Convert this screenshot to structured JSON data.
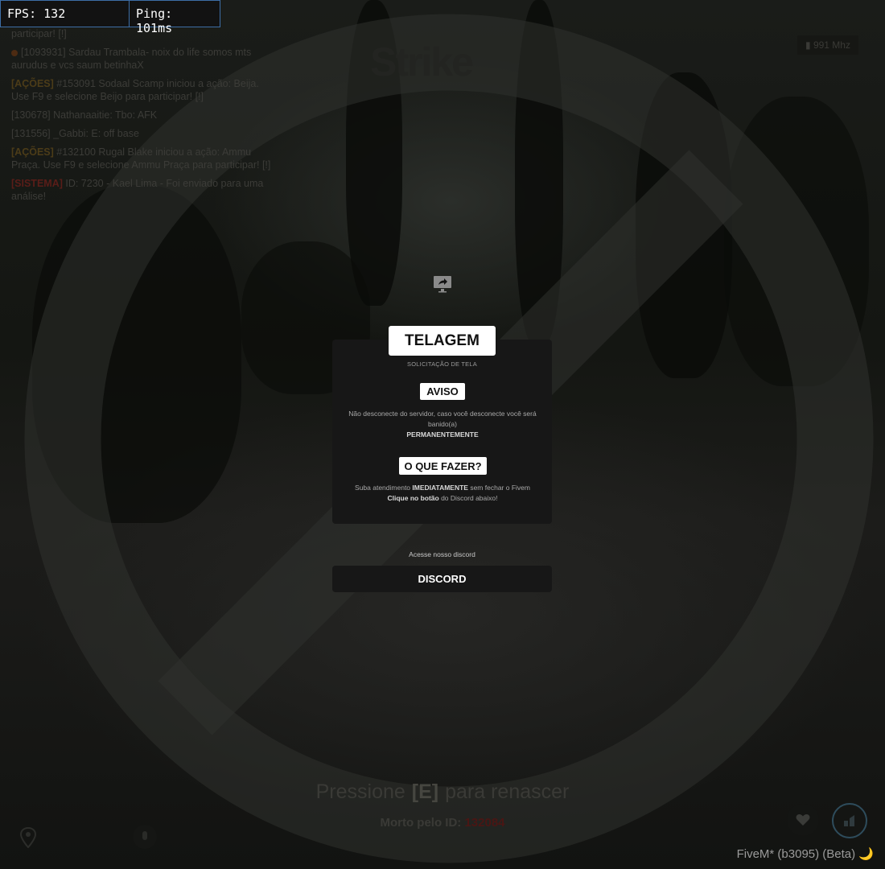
{
  "hud": {
    "fps": "FPS: 132",
    "ping": "Ping: 101ms"
  },
  "chat": [
    {
      "text": "participar! [!]"
    },
    {
      "tag": "",
      "text": "[1093931] Sardau Trambala- noix do life somos mts aurudus e vcs saum betinhaX"
    },
    {
      "tag": "[AÇÕES]",
      "text": " #153091 Sodaal Scamp iniciou a ação: Beija. Use F9 e selecione Beijo para participar! [!]"
    },
    {
      "tag": "",
      "text": "[130678] Nathanaaitie: Tbo: AFK"
    },
    {
      "tag": "",
      "text": "[131556] _Gabbi: E: off base"
    },
    {
      "tag": "[AÇÕES]",
      "text": " #132100 Rugal Blake iniciou a ação: Ammu Praça. Use F9 e selecione Ammu Praça para participar! [!]"
    },
    {
      "tag": "[SISTEMA]",
      "text": " ID: 7230 - Kael Lima - Foi enviado para uma análise!"
    }
  ],
  "brand": "Strike",
  "frequency": "991 Mhz",
  "modal": {
    "title": "TELAGEM",
    "subtitle": "SOLICITAÇÃO DE TELA",
    "warning_badge": "AVISO",
    "warning_text_1": "Não desconecte do servidor, caso você desconecte você será banido(a)",
    "warning_text_bold": "PERMANENTEMENTE",
    "todo_badge": "O QUE FAZER?",
    "todo_text_1": "Suba atendimento ",
    "todo_text_bold_1": "IMEDIATAMENTE",
    "todo_text_2": " sem fechar o Fivem ",
    "todo_text_bold_2": "Clique no botão",
    "todo_text_3": " do Discord abaixo!",
    "discord_label": "Acesse nosso discord",
    "discord_button": "DISCORD"
  },
  "respawn": {
    "prefix": "Pressione",
    "key": "[E]",
    "suffix": "para renascer"
  },
  "killer": {
    "label": "Morto pelo ID:",
    "id": "132084"
  },
  "footer": "FiveM* (b3095) (Beta) 🌙",
  "colors": {
    "panel": "#171717",
    "hud_border": "#3d6ea6",
    "killer_id": "#4a1614"
  },
  "icons": [
    "share-screen-icon",
    "map-pin-icon",
    "microphone-icon",
    "heart-icon",
    "brand-logo-icon",
    "signal-icon"
  ]
}
